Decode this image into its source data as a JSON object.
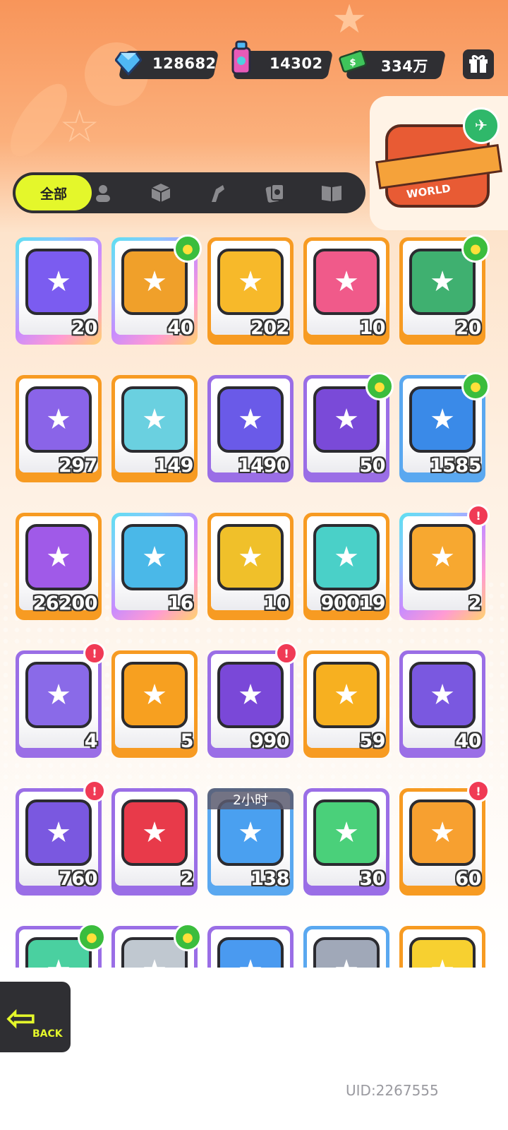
{
  "currencies": [
    {
      "name": "diamond",
      "icon": "diamond-icon",
      "value": "128682",
      "color": "#4fb8f5"
    },
    {
      "name": "spray-can",
      "icon": "spray-can-icon",
      "value": "14302",
      "color": "#e85ab8"
    },
    {
      "name": "cash",
      "icon": "cash-icon",
      "value": "334万",
      "color": "#3fc45a"
    }
  ],
  "world_box": {
    "label": "WORLD"
  },
  "tabs": [
    {
      "label": "全部",
      "icon": "all-tab",
      "active": true
    },
    {
      "icon": "character-icon"
    },
    {
      "icon": "box-icon"
    },
    {
      "icon": "spray-icon"
    },
    {
      "icon": "cards-icon"
    },
    {
      "icon": "book-icon"
    }
  ],
  "items": [
    {
      "qty": "20",
      "border": "rainbow",
      "icon": "crown-ticket-icon",
      "art_color": "#7b5cf0"
    },
    {
      "qty": "40",
      "border": "rainbow",
      "icon": "lion-ticket-icon",
      "art_color": "#f0a02a",
      "badge": "new"
    },
    {
      "qty": "202",
      "border": "orange",
      "icon": "gold-star-ticket-icon",
      "art_color": "#f7b92a"
    },
    {
      "qty": "10",
      "border": "orange",
      "icon": "character-ticket-icon",
      "art_color": "#f05a8a"
    },
    {
      "qty": "20",
      "border": "orange",
      "icon": "food-ticket-icon",
      "art_color": "#3fb070",
      "badge": "new"
    },
    {
      "qty": "297",
      "border": "orange",
      "icon": "purple-star-ticket-icon",
      "art_color": "#8a64e8"
    },
    {
      "qty": "149",
      "border": "orange",
      "icon": "rainbow-star-icon",
      "art_color": "#6ad0e0"
    },
    {
      "qty": "1490",
      "border": "purple",
      "icon": "purple-star-icon",
      "art_color": "#6a5ae8"
    },
    {
      "qty": "50",
      "border": "purple",
      "icon": "purple-crayon-icon",
      "art_color": "#7a4ad8",
      "badge": "new"
    },
    {
      "qty": "1585",
      "border": "blue",
      "icon": "blue-crayon-icon",
      "art_color": "#3a8ae8",
      "badge": "new"
    },
    {
      "qty": "26200",
      "border": "orange",
      "icon": "cool-coin-icon",
      "art_color": "#a05ae8"
    },
    {
      "qty": "16",
      "border": "rainbow",
      "icon": "lottery-ticket-icon",
      "art_color": "#4ab8e8"
    },
    {
      "qty": "10",
      "border": "orange",
      "icon": "star-coin-icon",
      "art_color": "#f0c02a"
    },
    {
      "qty": "90019",
      "border": "orange",
      "icon": "season-ticket-icon",
      "art_color": "#4ad0c8"
    },
    {
      "qty": "2",
      "border": "rainbow",
      "icon": "cool-box-icon",
      "art_color": "#f7a830",
      "badge": "alert"
    },
    {
      "qty": "4",
      "border": "purple",
      "icon": "travel-card-icon",
      "art_color": "#8a6ae8",
      "badge": "alert"
    },
    {
      "qty": "5",
      "border": "orange",
      "icon": "orange-egg-icon",
      "art_color": "#f7a020"
    },
    {
      "qty": "990",
      "border": "purple",
      "icon": "purple-egg-icon",
      "art_color": "#7a48d8",
      "badge": "alert"
    },
    {
      "qty": "59",
      "border": "orange",
      "icon": "deity-gold-icon",
      "art_color": "#f7b020"
    },
    {
      "qty": "40",
      "border": "purple",
      "icon": "deity-purple-icon",
      "art_color": "#7a58e0"
    },
    {
      "qty": "760",
      "border": "purple",
      "icon": "mystery-travel-card-icon",
      "art_color": "#7a58e0",
      "badge": "alert"
    },
    {
      "qty": "2",
      "border": "purple",
      "icon": "fish-coin-icon",
      "art_color": "#e83a4a"
    },
    {
      "qty": "138",
      "border": "blue",
      "icon": "alarm-clock-icon",
      "art_color": "#4aa0f0",
      "timer": "2小时"
    },
    {
      "qty": "30",
      "border": "purple",
      "icon": "green-cup-icon",
      "art_color": "#4ad07a"
    },
    {
      "qty": "60",
      "border": "orange",
      "icon": "cool-box-fish-icon",
      "art_color": "#f7a030",
      "badge": "alert"
    },
    {
      "qty": "",
      "border": "purple",
      "icon": "green-spray-icon",
      "art_color": "#4ad0a0",
      "badge": "new"
    },
    {
      "qty": "",
      "border": "purple",
      "icon": "white-can-icon",
      "art_color": "#c0c8d0",
      "badge": "new"
    },
    {
      "qty": "",
      "border": "purple",
      "icon": "blue-spray-icon",
      "art_color": "#4a9af0"
    },
    {
      "qty": "",
      "border": "blue",
      "icon": "grey-can-icon",
      "art_color": "#a0a8b8"
    },
    {
      "qty": "",
      "border": "orange",
      "icon": "yellow-gem-icon",
      "art_color": "#f7d030"
    }
  ],
  "back_button": {
    "label": "BACK"
  },
  "uid": "UID:2267555"
}
